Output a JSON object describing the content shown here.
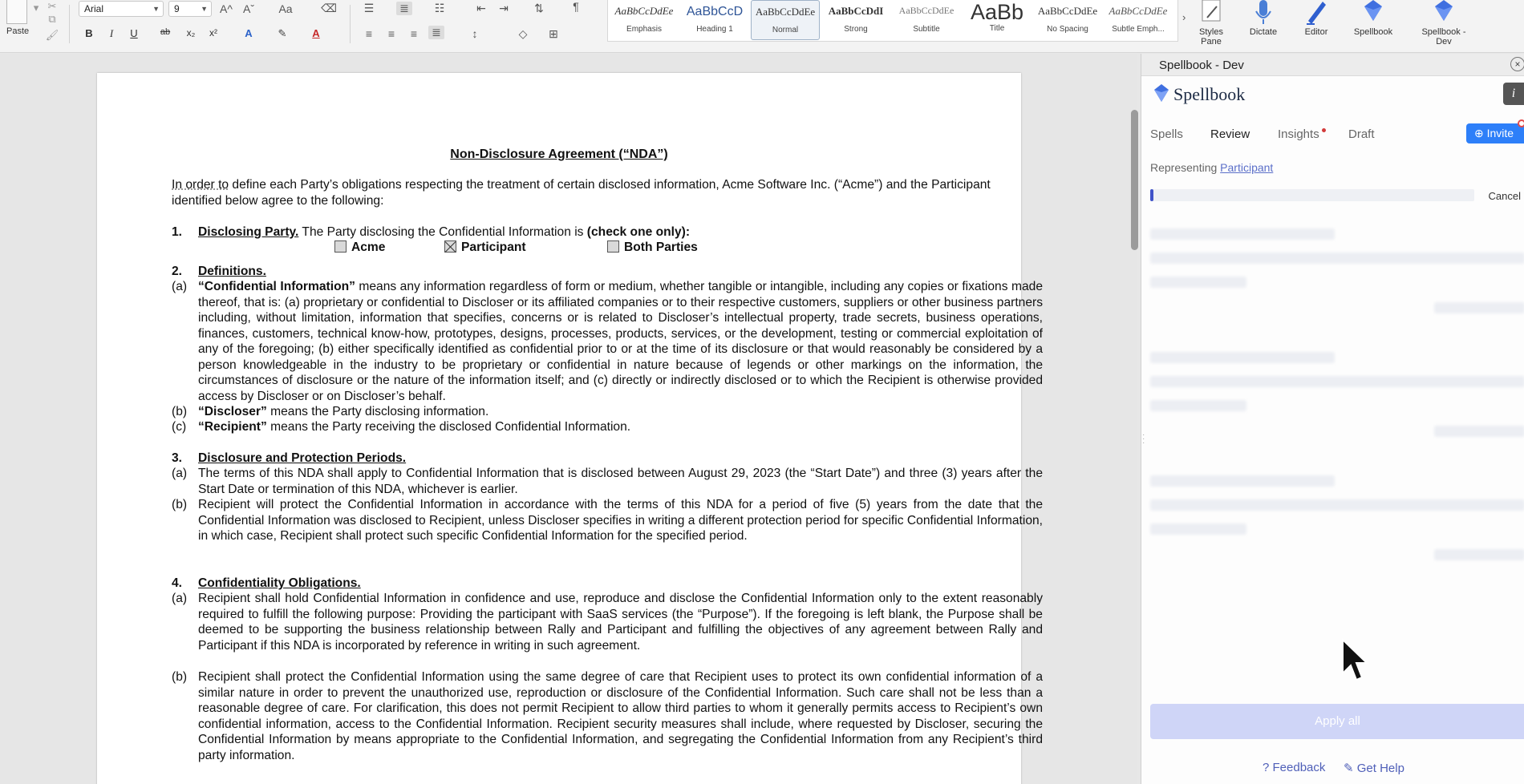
{
  "ribbon": {
    "paste_label": "Paste",
    "font_name": "Arial",
    "font_size": "9",
    "bold": "B",
    "italic": "I",
    "underline": "U",
    "strike": "ab",
    "subscript": "x₂",
    "superscript": "x²",
    "grow_font": "A^",
    "shrink_font": "Aˇ",
    "change_case": "Aa",
    "styles": [
      {
        "sample": "AaBbCcDdEe",
        "name": "Emphasis"
      },
      {
        "sample": "AaBbCcD",
        "name": "Heading 1"
      },
      {
        "sample": "AaBbCcDdEe",
        "name": "Normal"
      },
      {
        "sample": "AaBbCcDdI",
        "name": "Strong"
      },
      {
        "sample": "AaBbCcDdEe",
        "name": "Subtitle"
      },
      {
        "sample": "AaBb",
        "name": "Title"
      },
      {
        "sample": "AaBbCcDdEe",
        "name": "No Spacing"
      },
      {
        "sample": "AaBbCcDdEe",
        "name": "Subtle Emph..."
      }
    ],
    "styles_pane": "Styles\nPane",
    "dictate": "Dictate",
    "editor": "Editor",
    "spellbook": "Spellbook",
    "spellbook_dev": "Spellbook -\nDev"
  },
  "document": {
    "title": "Non-Disclosure Agreement (“NDA”)",
    "intro_first": "In order to",
    "intro_rest": " define each Party’s obligations respecting the treatment of certain disclosed information, Acme Software Inc. (“Acme”) and the Participant identified below agree to the following:",
    "s1_num": "1.",
    "s1_head": "Disclosing Party.",
    "s1_text": "  The Party disclosing the Confidential Information is ",
    "s1_bold": "(check one only):",
    "check_acme": "Acme",
    "check_participant": "Participant",
    "check_both": "Both Parties",
    "s2_num": "2.",
    "s2_head": "Definitions.",
    "s2a_label": "(a)",
    "s2a_term": "“Confidential Information”",
    "s2a_text": " means any information regardless of form or medium, whether tangible or intangible, including any copies or fixations made thereof, that is: (a) proprietary or confidential to Discloser or its affiliated companies or to their respective customers, suppliers or other business partners including, without limitation, information that specifies, concerns or is related to Discloser’s intellectual property, trade secrets, business operations, finances, customers, technical know-how, prototypes, designs, processes, products, services, or the development, testing or commercial exploitation of any of the foregoing; (b) either specifically identified as confidential prior to or at the time of its disclosure or that would reasonably be considered by a person knowledgeable in the industry to be proprietary or confidential in nature because of legends or other markings on the information, the circumstances of disclosure or the nature of the information itself; and (c) directly or indirectly disclosed or to which the Recipient is otherwise provided access by Discloser or on Discloser’s behalf.",
    "s2b_label": "(b)",
    "s2b_term": "“Discloser”",
    "s2b_text": " means the Party disclosing information.",
    "s2c_label": "(c)",
    "s2c_term": "“Recipient”",
    "s2c_text": " means the Party receiving the disclosed Confidential Information.",
    "s3_num": "3.",
    "s3_head": "Disclosure and Protection Periods.",
    "s3a_label": "(a)",
    "s3a_text": "The terms of this NDA shall apply to Confidential Information that is disclosed between August 29, 2023 (the “Start Date”) and three (3) years after the Start Date or termination of this NDA, whichever is earlier.",
    "s3b_label": "(b)",
    "s3b_text": "Recipient will protect the Confidential Information in accordance with the terms of this NDA for a period of five (5) years from the date that the Confidential Information was disclosed to Recipient, unless Discloser specifies in writing a different protection period for specific Confidential Information, in which case, Recipient shall protect such specific Confidential Information for the specified period.",
    "s4_num": "4.",
    "s4_head": "Confidentiality Obligations.",
    "s4a_label": "(a)",
    "s4a_text": "Recipient shall hold Confidential Information in confidence and use, reproduce and disclose the Confidential Information only to the extent reasonably required to fulfill the following purpose: Providing the participant with SaaS services (the “Purpose”). If the foregoing is left blank, the Purpose shall be deemed to be supporting the business relationship between Rally and Participant and fulfilling the objectives of any agreement between Rally and Participant if this NDA is incorporated by reference in writing in such agreement.",
    "s4b_label": "(b)",
    "s4b_text": "Recipient shall protect the Confidential Information using the same degree of care that Recipient uses to protect its own confidential information of a similar nature in order to prevent the unauthorized use, reproduction or disclosure of the Confidential Information.  Such care shall not be less than a reasonable degree of care.  For clarification, this does not permit Recipient to allow third parties to whom it generally permits access to Recipient’s own confidential information, access to the Confidential Information. Recipient security measures shall include, where requested by Discloser, securing the Confidential Information by means appropriate to the Confidential Information, and segregating the Confidential Information from any Recipient’s third party information."
  },
  "pane": {
    "title": "Spellbook - Dev",
    "close_glyph": "×",
    "brand": "Spellbook",
    "info_glyph": "i",
    "tabs": [
      "Spells",
      "Review",
      "Insights",
      "Draft"
    ],
    "active_tab": "Review",
    "invite_label": "Invite",
    "representing_label": "Representing",
    "representing_value": "Participant",
    "cancel_label": "Cancel",
    "progress_fraction": 0.01,
    "apply_all_label": "Apply all",
    "feedback_label": "Feedback",
    "get_help_label": "Get Help",
    "help_glyph": "?"
  },
  "colors": {
    "accent": "#2d7ff9",
    "brand_blue": "#3f52c8",
    "link": "#5b6fc9",
    "notification": "#d23b3b"
  },
  "icons": [
    "paste-icon",
    "format-painter-icon",
    "microphone-icon",
    "editor-pen-icon",
    "spellbook-gem-icon",
    "close-icon",
    "info-icon",
    "add-user-icon",
    "feedback-icon",
    "help-doc-icon",
    "mouse-cursor-icon"
  ]
}
